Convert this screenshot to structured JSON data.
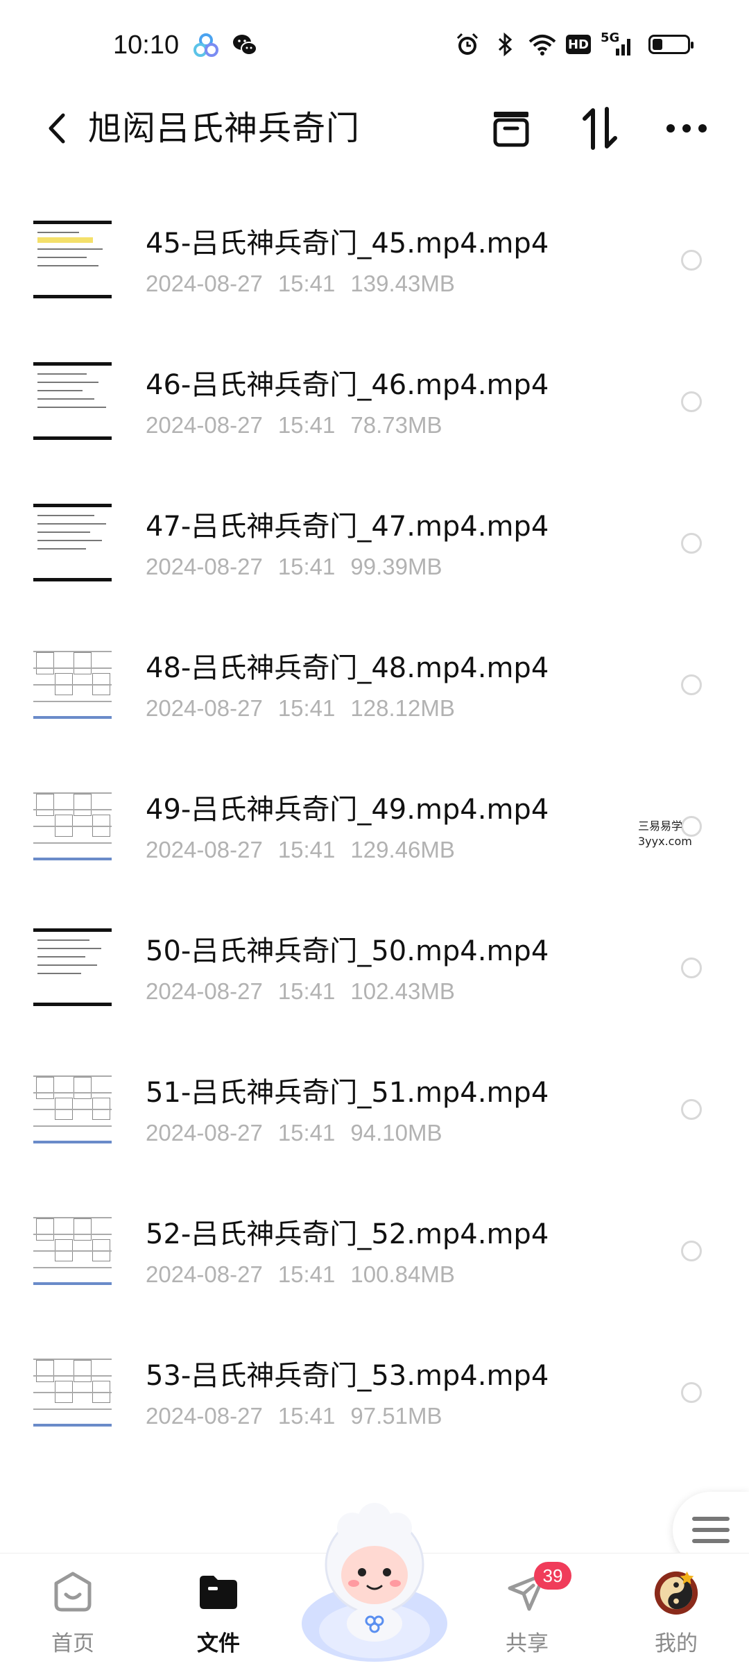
{
  "status_bar": {
    "time": "10:10",
    "icons": [
      "cloud-app-icon",
      "wechat-icon",
      "alarm-icon",
      "bluetooth-icon",
      "wifi-icon",
      "hd-icon",
      "signal-5g-icon",
      "battery-icon"
    ],
    "hd_label": "HD",
    "network_label": "5G",
    "battery_level": 0.3
  },
  "header": {
    "title": "旭闳吕氏神兵奇门",
    "icons": [
      "back-icon",
      "archive-icon",
      "sort-icon",
      "more-icon"
    ]
  },
  "files": [
    {
      "name": "45-吕氏神兵奇门_45.mp4.mp4",
      "date": "2024-08-27",
      "time": "15:41",
      "size": "139.43MB"
    },
    {
      "name": "46-吕氏神兵奇门_46.mp4.mp4",
      "date": "2024-08-27",
      "time": "15:41",
      "size": "78.73MB"
    },
    {
      "name": "47-吕氏神兵奇门_47.mp4.mp4",
      "date": "2024-08-27",
      "time": "15:41",
      "size": "99.39MB"
    },
    {
      "name": "48-吕氏神兵奇门_48.mp4.mp4",
      "date": "2024-08-27",
      "time": "15:41",
      "size": "128.12MB"
    },
    {
      "name": "49-吕氏神兵奇门_49.mp4.mp4",
      "date": "2024-08-27",
      "time": "15:41",
      "size": "129.46MB"
    },
    {
      "name": "50-吕氏神兵奇门_50.mp4.mp4",
      "date": "2024-08-27",
      "time": "15:41",
      "size": "102.43MB"
    },
    {
      "name": "51-吕氏神兵奇门_51.mp4.mp4",
      "date": "2024-08-27",
      "time": "15:41",
      "size": "94.10MB"
    },
    {
      "name": "52-吕氏神兵奇门_52.mp4.mp4",
      "date": "2024-08-27",
      "time": "15:41",
      "size": "100.84MB"
    },
    {
      "name": "53-吕氏神兵奇门_53.mp4.mp4",
      "date": "2024-08-27",
      "time": "15:41",
      "size": "97.51MB"
    }
  ],
  "watermark": {
    "line1": "三易易学",
    "line2": "3yyx.com"
  },
  "bottom_nav": {
    "items": [
      {
        "label": "首页",
        "icon": "home-icon"
      },
      {
        "label": "文件",
        "icon": "folder-icon",
        "active": true
      },
      {
        "label": "",
        "icon": "mascot-icon"
      },
      {
        "label": "共享",
        "icon": "share-plane-icon",
        "badge": "39"
      },
      {
        "label": "我的",
        "icon": "avatar-icon"
      }
    ]
  },
  "colors": {
    "badge": "#f03c5a",
    "meta_text": "#b2b2b2",
    "title_text": "#111111"
  }
}
